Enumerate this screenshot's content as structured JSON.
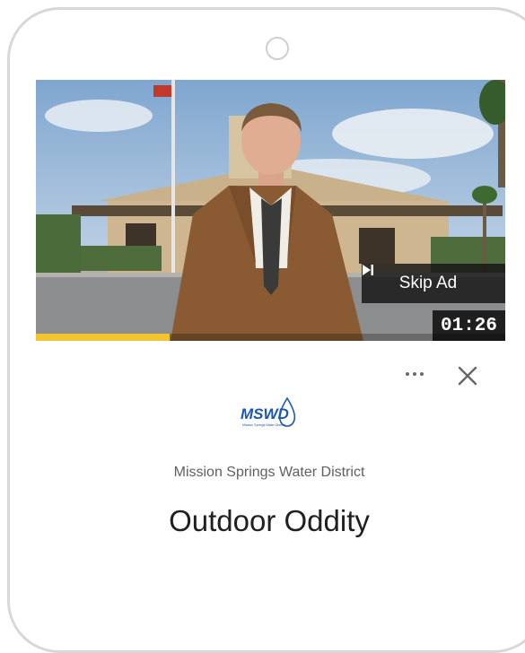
{
  "ad": {
    "skip_label": "Skip Ad",
    "timer": "01:26",
    "progress": 0.285
  },
  "advertiser": {
    "logo_text": "MSWD",
    "logo_subtext": "Mission Springs Water District",
    "name": "Mission Springs Water District"
  },
  "title": "Outdoor Oddity",
  "icons": {
    "more": "more-options-icon",
    "close": "close-icon",
    "skip": "skip-next-icon"
  },
  "colors": {
    "progress": "#f4c430",
    "logo_blue": "#1a56b4"
  }
}
